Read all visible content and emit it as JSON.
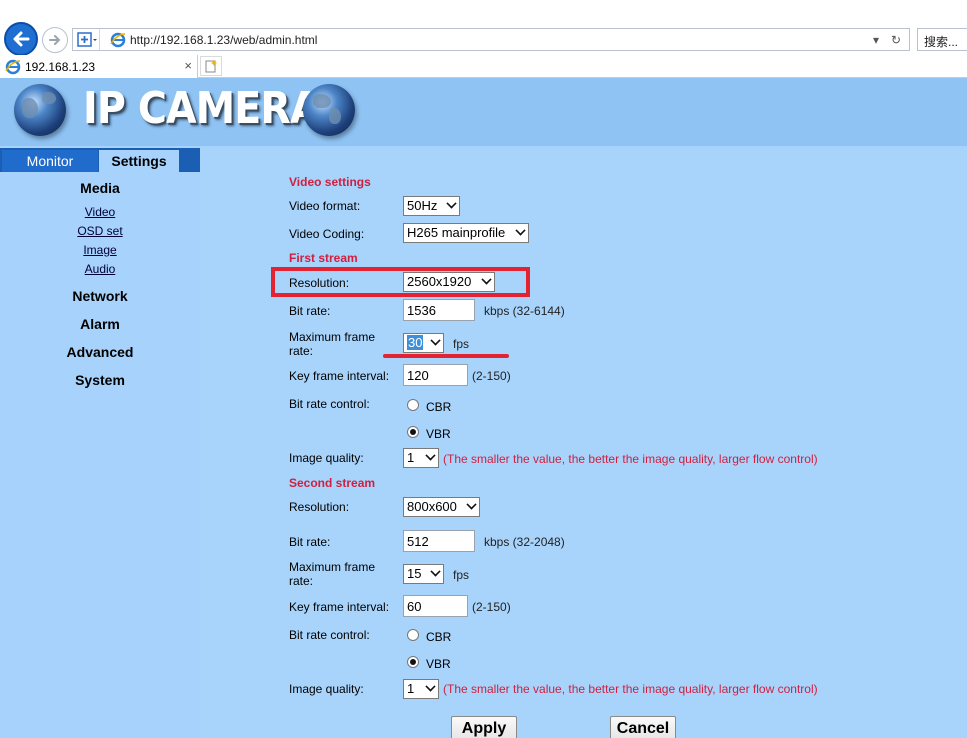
{
  "browser": {
    "url": "http://192.168.1.23/web/admin.html",
    "search_label": "搜索...",
    "tab_title": "192.168.1.23",
    "tab_close": "×"
  },
  "header": {
    "logo_text": "IP CAMERA"
  },
  "menu": {
    "monitor": "Monitor",
    "settings": "Settings"
  },
  "sidebar": {
    "media": "Media",
    "links": [
      "Video",
      "OSD set",
      "Image",
      "Audio"
    ],
    "network": "Network",
    "alarm": "Alarm",
    "advanced": "Advanced",
    "system": "System"
  },
  "video_settings": {
    "title": "Video settings",
    "format_label": "Video format:",
    "format_value": "50Hz",
    "coding_label": "Video Coding:",
    "coding_value": "H265 mainprofile"
  },
  "first_stream": {
    "title": "First stream",
    "resolution_label": "Resolution:",
    "resolution_value": "2560x1920",
    "bitrate_label": "Bit rate:",
    "bitrate_value": "1536",
    "bitrate_hint": "kbps (32-6144)",
    "framerate_label_1": "Maximum frame",
    "framerate_label_2": "rate:",
    "framerate_value": "30",
    "fps_unit": "fps",
    "keyframe_label": "Key frame interval:",
    "keyframe_value": "120",
    "keyframe_hint": "(2-150)",
    "ratecontrol_label": "Bit rate control:",
    "cbr": "CBR",
    "vbr": "VBR",
    "quality_label": "Image quality:",
    "quality_value": "1",
    "quality_hint": "(The smaller the value, the better the image quality, larger flow control)"
  },
  "second_stream": {
    "title": "Second stream",
    "resolution_label": "Resolution:",
    "resolution_value": "800x600",
    "bitrate_label": "Bit rate:",
    "bitrate_value": "512",
    "bitrate_hint": "kbps (32-2048)",
    "framerate_label_1": "Maximum frame",
    "framerate_label_2": "rate:",
    "framerate_value": "15",
    "fps_unit": "fps",
    "keyframe_label": "Key frame interval:",
    "keyframe_value": "60",
    "keyframe_hint": "(2-150)",
    "ratecontrol_label": "Bit rate control:",
    "cbr": "CBR",
    "vbr": "VBR",
    "quality_label": "Image quality:",
    "quality_value": "1",
    "quality_hint": "(The smaller the value, the better the image quality, larger flow control)"
  },
  "actions": {
    "apply": "Apply",
    "cancel": "Cancel"
  },
  "colors": {
    "accent_red": "#d02040",
    "page_bg": "#a7d2fb",
    "menu_blue": "#1a5fb4"
  }
}
